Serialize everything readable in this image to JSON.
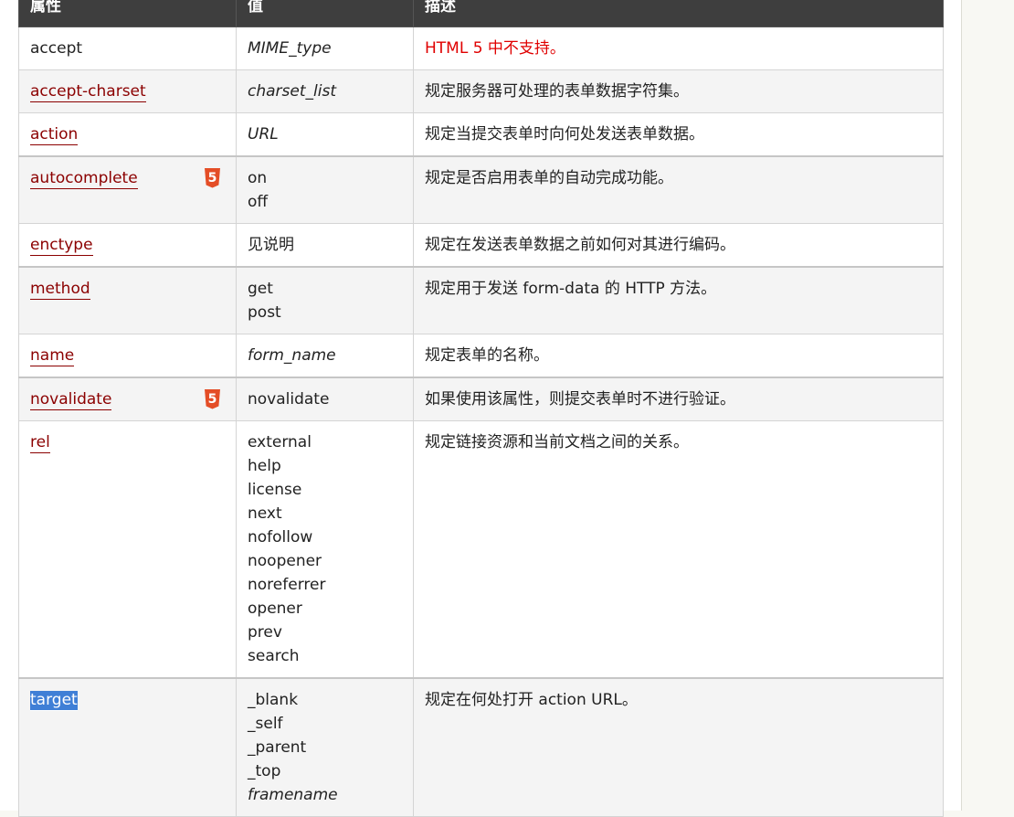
{
  "headers": {
    "attr": "属性",
    "value": "值",
    "desc": "描述"
  },
  "rows": [
    {
      "attr": "accept",
      "linked": false,
      "html5": false,
      "values": [
        "MIME_type"
      ],
      "italic": true,
      "desc": "HTML 5 中不支持。",
      "desc_red": true
    },
    {
      "attr": "accept-charset",
      "linked": true,
      "html5": false,
      "values": [
        "charset_list"
      ],
      "italic": true,
      "desc": "规定服务器可处理的表单数据字符集。",
      "desc_red": false
    },
    {
      "attr": "action",
      "linked": true,
      "html5": false,
      "values": [
        "URL"
      ],
      "italic": true,
      "desc": "规定当提交表单时向何处发送表单数据。",
      "desc_red": false
    },
    {
      "attr": "autocomplete",
      "linked": true,
      "html5": true,
      "values": [
        "on",
        "off"
      ],
      "italic": false,
      "desc": "规定是否启用表单的自动完成功能。",
      "desc_red": false
    },
    {
      "attr": "enctype",
      "linked": true,
      "html5": false,
      "values": [
        "见说明"
      ],
      "italic": false,
      "desc": "规定在发送表单数据之前如何对其进行编码。",
      "desc_red": false
    },
    {
      "attr": "method",
      "linked": true,
      "html5": false,
      "values": [
        "get",
        "post"
      ],
      "italic": false,
      "desc": "规定用于发送 form-data 的 HTTP 方法。",
      "desc_red": false
    },
    {
      "attr": "name",
      "linked": true,
      "html5": false,
      "values": [
        "form_name"
      ],
      "italic": true,
      "desc": "规定表单的名称。",
      "desc_red": false
    },
    {
      "attr": "novalidate",
      "linked": true,
      "html5": true,
      "values": [
        "novalidate"
      ],
      "italic": false,
      "desc": "如果使用该属性，则提交表单时不进行验证。",
      "desc_red": false
    },
    {
      "attr": "rel",
      "linked": true,
      "html5": false,
      "values": [
        "external",
        "help",
        "license",
        "next",
        "nofollow",
        "noopener",
        "noreferrer",
        "opener",
        "prev",
        "search"
      ],
      "italic": false,
      "desc": "规定链接资源和当前文档之间的关系。",
      "desc_red": false
    },
    {
      "attr": "target",
      "linked": true,
      "selected": true,
      "html5": false,
      "values": [
        "_blank",
        "_self",
        "_parent",
        "_top",
        "framename"
      ],
      "italic_last": true,
      "italic": false,
      "desc": "规定在何处打开 action URL。",
      "desc_red": false
    }
  ],
  "colors": {
    "header_bg": "#3e3e3e",
    "link": "#8b0000",
    "selection": "#3f7fd6",
    "warning": "#e00000",
    "html5_badge": "#e44d26"
  },
  "icons": {
    "html5": "html5-badge-icon"
  }
}
